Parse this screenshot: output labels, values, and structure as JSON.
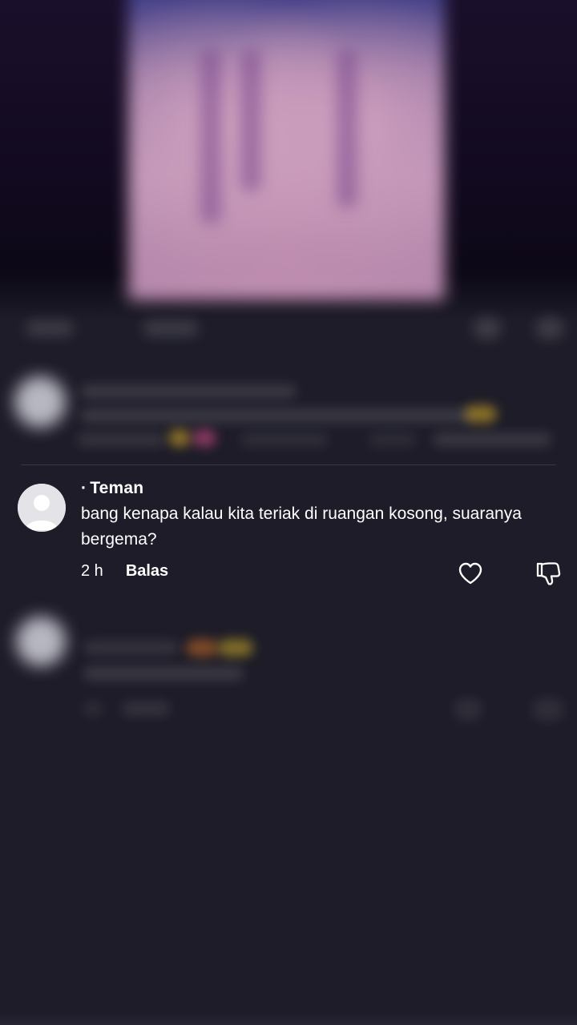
{
  "comment": {
    "username": "Teman",
    "username_prefix": "·",
    "text": "bang kenapa kalau kita teriak di ruangan kosong, suaranya bergema?",
    "time": "2 h",
    "reply_label": "Balas",
    "like_icon": "heart-outline-icon",
    "dislike_icon": "thumbs-down-outline-icon"
  },
  "colors": {
    "background": "#1d1c28",
    "text": "#ffffff",
    "divider": "#3a3944"
  }
}
